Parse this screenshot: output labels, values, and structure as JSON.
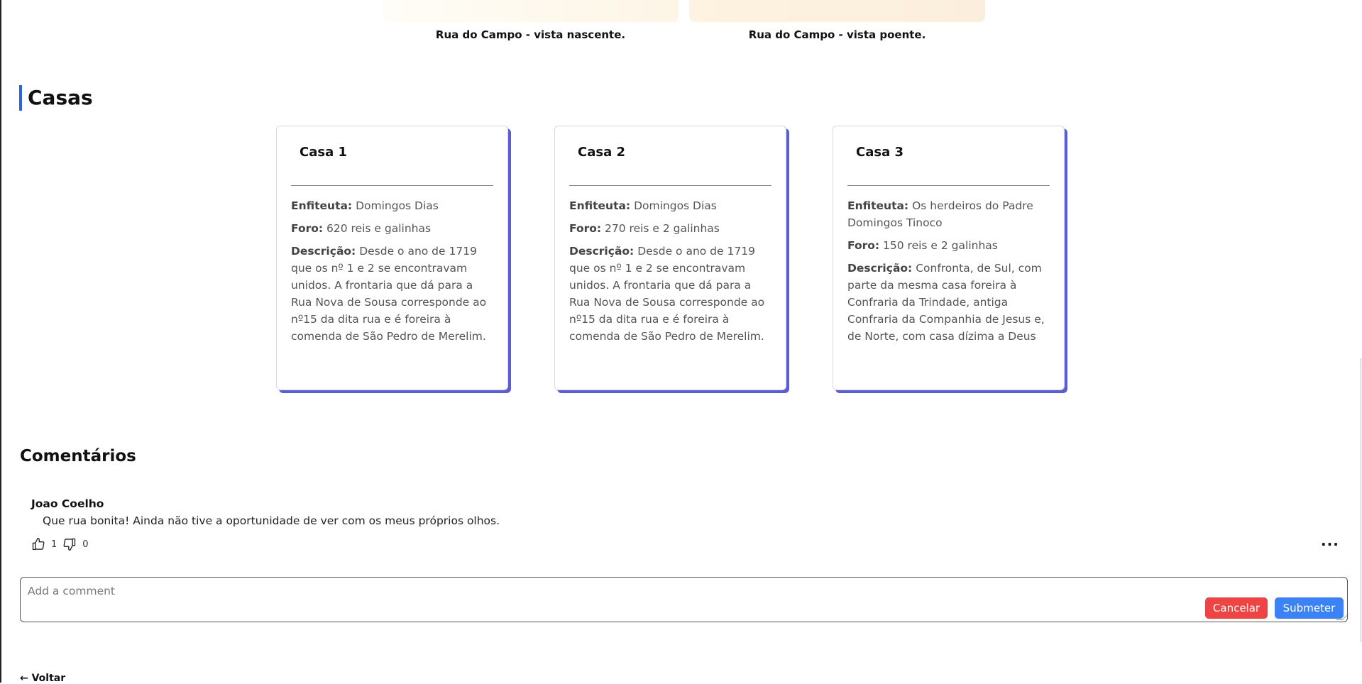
{
  "gallery": {
    "captions": [
      "Rua do Campo - vista nascente.",
      "Rua do Campo - vista poente."
    ]
  },
  "casas": {
    "title": "Casas",
    "cards": [
      {
        "title": "Casa 1",
        "enfiteuta_label": "Enfiteuta:",
        "enfiteuta": "Domingos Dias",
        "foro_label": "Foro:",
        "foro": "620 reis e galinhas",
        "descricao_label": "Descrição:",
        "descricao": "Desde o ano de 1719 que os nº 1 e 2 se encontravam unidos. A frontaria que dá para a Rua Nova de Sousa corresponde ao nº15 da dita rua e é foreira à comenda de São Pedro de Merelim."
      },
      {
        "title": "Casa 2",
        "enfiteuta_label": "Enfiteuta:",
        "enfiteuta": "Domingos Dias",
        "foro_label": "Foro:",
        "foro": "270 reis e 2 galinhas",
        "descricao_label": "Descrição:",
        "descricao": "Desde o ano de 1719 que os nº 1 e 2 se encontravam unidos. A frontaria que dá para a Rua Nova de Sousa corresponde ao nº15 da dita rua e é foreira à comenda de São Pedro de Merelim."
      },
      {
        "title": "Casa 3",
        "enfiteuta_label": "Enfiteuta:",
        "enfiteuta": "Os herdeiros do Padre Domingos Tinoco",
        "foro_label": "Foro:",
        "foro": "150 reis e 2 galinhas",
        "descricao_label": "Descrição:",
        "descricao": "Confronta, de Sul, com parte da mesma casa foreira à Confraria da Trindade, antiga Confraria da Companhia de Jesus e, de Norte, com casa dízima a Deus"
      }
    ]
  },
  "comments": {
    "title": "Comentários",
    "items": [
      {
        "author": "Joao Coelho",
        "text": "Que rua bonita! Ainda não tive a oportunidade de ver com os meus próprios olhos.",
        "likes": "1",
        "dislikes": "0",
        "more": "···"
      }
    ],
    "input": {
      "placeholder": "Add a comment",
      "value": ""
    },
    "cancel_label": "Cancelar",
    "submit_label": "Submeter"
  },
  "nav": {
    "back_label": "← Voltar"
  },
  "icons": {
    "like": "thumbs-up-icon",
    "dislike": "thumbs-down-icon",
    "more": "more-horizontal-icon"
  },
  "colors": {
    "accent": "#2f63e0",
    "card_shadow": "#5b5bdc",
    "cancel": "#ee4444",
    "submit": "#3b82f6"
  }
}
